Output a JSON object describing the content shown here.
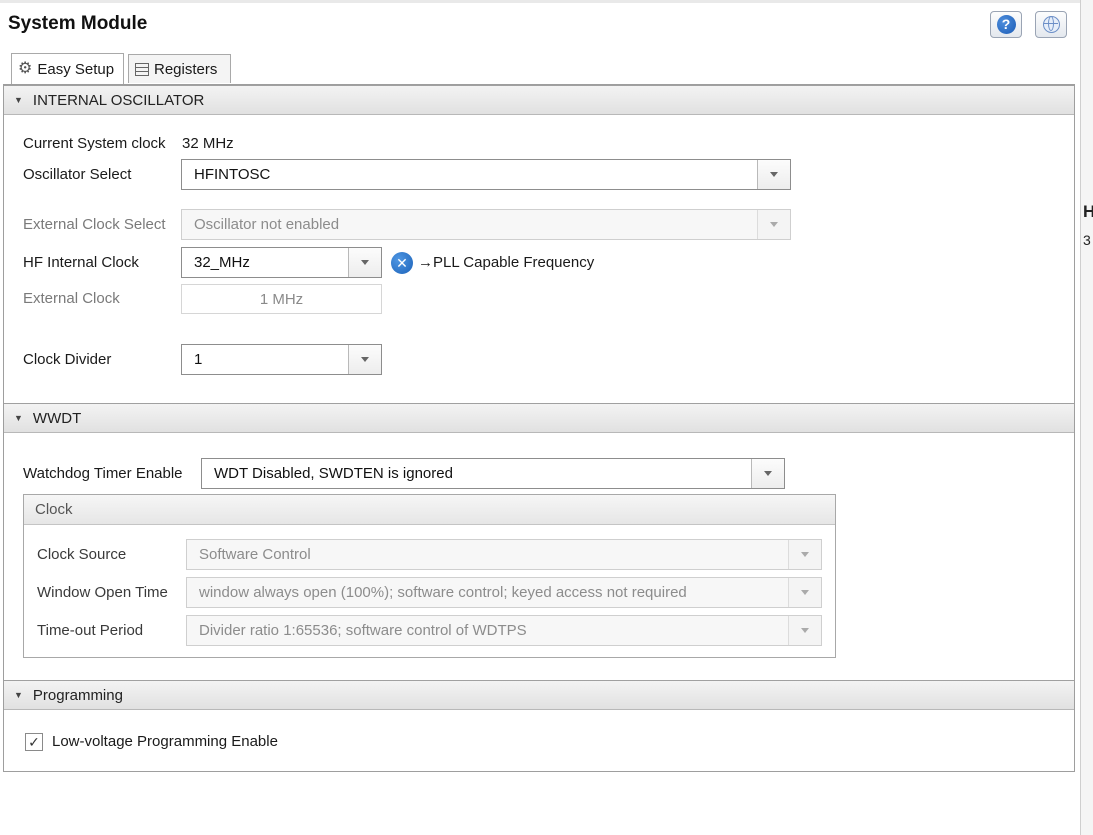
{
  "window": {
    "title": "System Module"
  },
  "header": {
    "help_icon": "help-icon",
    "help_glyph": "?",
    "globe_icon": "globe-icon"
  },
  "tabs": [
    {
      "label": "Easy Setup",
      "icon": "gear-icon",
      "active": true
    },
    {
      "label": "Registers",
      "icon": "registers-icon",
      "active": false
    }
  ],
  "internal_oscillator": {
    "title": "INTERNAL OSCILLATOR",
    "current_clock_label": "Current System clock",
    "current_clock_value": "32 MHz",
    "oscillator_select_label": "Oscillator Select",
    "oscillator_select_value": "HFINTOSC",
    "external_clock_select_label": "External Clock Select",
    "external_clock_select_value": "Oscillator not enabled",
    "hf_internal_clock_label": "HF Internal Clock",
    "hf_internal_clock_value": "32_MHz",
    "pll_note": "→PLL Capable Frequency",
    "pll_icon": "close-circle-icon",
    "external_clock_label": "External Clock",
    "external_clock_value": "1 MHz",
    "clock_divider_label": "Clock Divider",
    "clock_divider_value": "1"
  },
  "wwdt": {
    "title": "WWDT",
    "wdt_enable_label": "Watchdog Timer Enable",
    "wdt_enable_value": "WDT Disabled, SWDTEN is ignored",
    "clock_group_title": "Clock",
    "clock_source_label": "Clock Source",
    "clock_source_value": "Software Control",
    "window_open_time_label": "Window Open Time",
    "window_open_time_value": "window always open (100%); software control; keyed access not required",
    "timeout_period_label": "Time-out Period",
    "timeout_period_value": "Divider ratio 1:65536; software control of WDTPS"
  },
  "programming": {
    "title": "Programming",
    "lvp_label": "Low-voltage Programming Enable",
    "lvp_checked": true
  },
  "side_panel": {
    "fragment_1": "H",
    "fragment_2": "3"
  },
  "glyphs": {
    "collapse": "▼",
    "check": "✓",
    "close": "✕"
  }
}
